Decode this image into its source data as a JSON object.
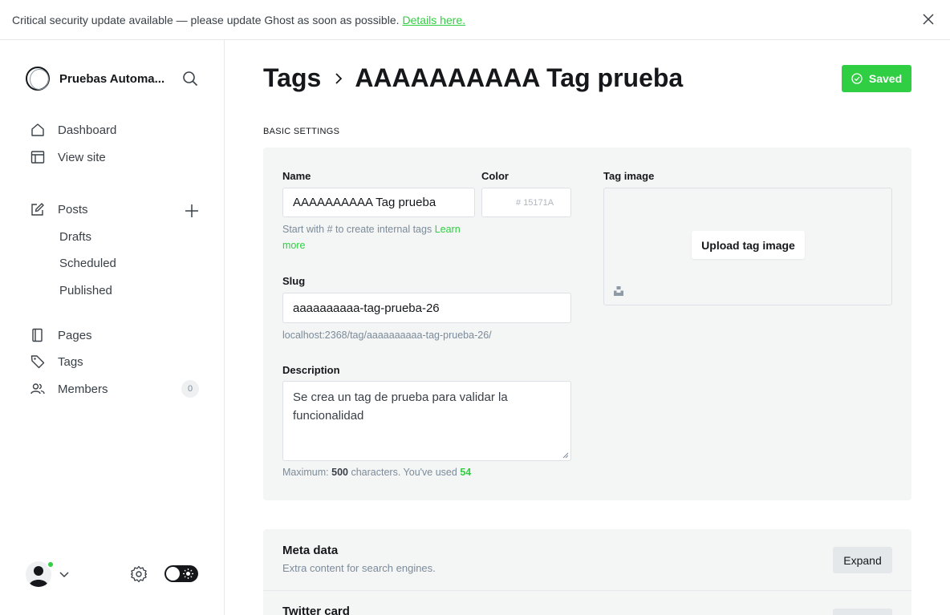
{
  "banner": {
    "message": "Critical security update available — please update Ghost as soon as possible.",
    "link": "Details here."
  },
  "sidebar": {
    "site_name": "Pruebas Automa...",
    "nav": {
      "dashboard": "Dashboard",
      "view_site": "View site",
      "posts": "Posts",
      "drafts": "Drafts",
      "scheduled": "Scheduled",
      "published": "Published",
      "pages": "Pages",
      "tags": "Tags",
      "members": "Members"
    },
    "members_count": "0"
  },
  "header": {
    "breadcrumb_root": "Tags",
    "title": "AAAAAAAAAA Tag prueba",
    "saved_label": "Saved"
  },
  "basic_settings": {
    "section_label": "BASIC SETTINGS",
    "name_label": "Name",
    "name_value": "AAAAAAAAAA Tag prueba",
    "name_hint": "Start with # to create internal tags",
    "learn": "Learn",
    "more": "more",
    "color_label": "Color",
    "color_hash": "#",
    "color_value": "15171A",
    "slug_label": "Slug",
    "slug_value": "aaaaaaaaaa-tag-prueba-26",
    "slug_url": "localhost:2368/tag/aaaaaaaaaa-tag-prueba-26/",
    "description_label": "Description",
    "description_line1": "Se crea un tag de prueba para validar la",
    "description_line2": "funcionalidad",
    "max_prefix": "Maximum:",
    "max_value": "500",
    "max_middle": "characters. You've used",
    "used_value": "54",
    "tag_image_label": "Tag image",
    "upload_label": "Upload tag image"
  },
  "meta": {
    "title": "Meta data",
    "subtitle": "Extra content for search engines.",
    "expand": "Expand"
  },
  "twitter": {
    "title": "Twitter card"
  },
  "colors": {
    "accent": "#30cf43",
    "text": "#15171a",
    "muted": "#7c8b9a",
    "panel": "#f4f5f5"
  }
}
